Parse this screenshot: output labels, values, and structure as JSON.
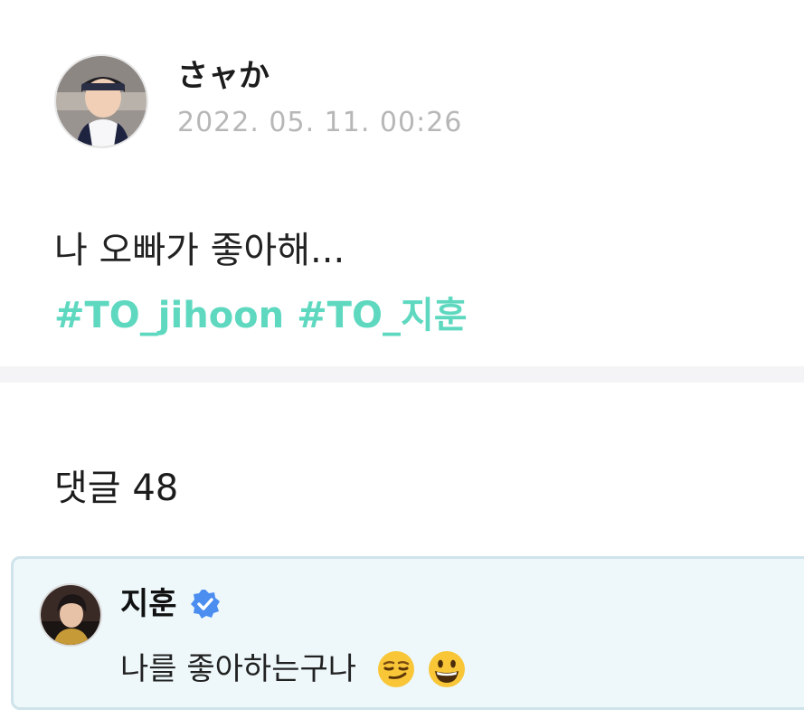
{
  "post": {
    "author_name": "さャか",
    "timestamp": "2022. 05. 11. 00:26",
    "text": "나 오빠가 좋아해...",
    "hashtags": [
      "#TO_jihoon",
      "#TO_지훈"
    ]
  },
  "comments": {
    "heading": "댓글 48",
    "items": [
      {
        "author": "지훈",
        "verified": true,
        "text": "나를 좋아하는구나",
        "emojis": [
          "smirking-face",
          "grinning-face"
        ]
      }
    ]
  },
  "colors": {
    "hashtag": "#5fd8c0",
    "timestamp": "#b7b7b7",
    "verified_badge": "#4b8ef0",
    "comment_bg": "#eef8fb",
    "comment_border": "#cfe3ea",
    "divider": "#f4f4f6"
  }
}
